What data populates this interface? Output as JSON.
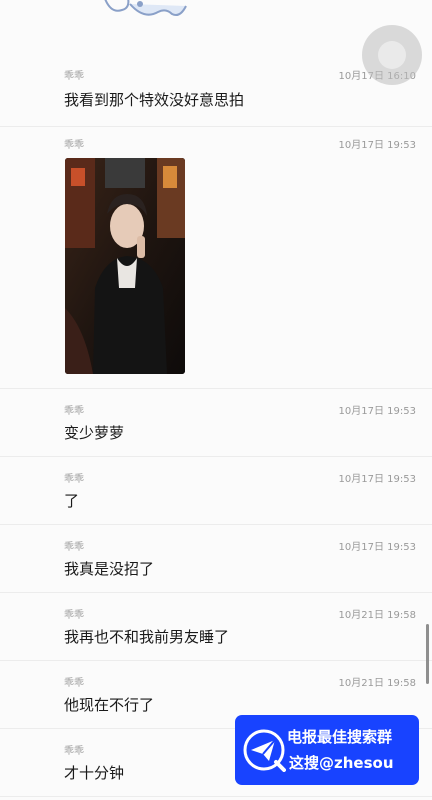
{
  "messages": [
    {
      "sender": "乖乖",
      "time": "10月17日 16:10",
      "text": "我看到那个特效没好意思拍"
    },
    {
      "sender": "乖乖",
      "time": "10月17日 19:53"
    },
    {
      "sender": "乖乖",
      "time": "10月17日 19:53",
      "text": "变少萝萝"
    },
    {
      "sender": "乖乖",
      "time": "10月17日 19:53",
      "text": "了"
    },
    {
      "sender": "乖乖",
      "time": "10月17日 19:53",
      "text": "我真是没招了"
    },
    {
      "sender": "乖乖",
      "time": "10月21日 19:58",
      "text": "我再也不和我前男友睡了"
    },
    {
      "sender": "乖乖",
      "time": "10月21日 19:58",
      "text": "他现在不行了"
    },
    {
      "sender": "乖乖",
      "text": "才十分钟"
    }
  ],
  "banner": {
    "line1": "电报最佳搜索群",
    "line2": "这搜@zhesou",
    "color": "#1843ff"
  },
  "icons": {
    "sticker": "cartoon-cat-sticker-icon",
    "floating": "floating-assistive-button",
    "banner": "telegram-paper-plane-icon"
  }
}
